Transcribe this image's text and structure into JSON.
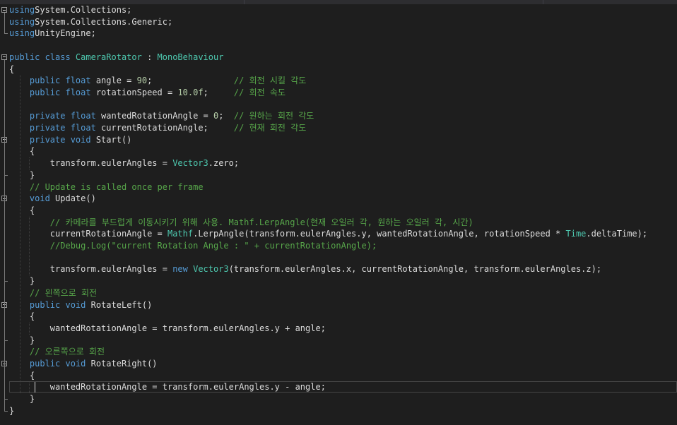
{
  "editor": {
    "language": "C#",
    "lines": [
      [
        [
          "kw",
          "using"
        ],
        [
          "",
          "System.Collections;"
        ]
      ],
      [
        [
          "kw",
          "using"
        ],
        [
          "",
          "System.Collections.Generic;"
        ]
      ],
      [
        [
          "kw",
          "using"
        ],
        [
          "",
          "UnityEngine;"
        ]
      ],
      [],
      [
        [
          "kw",
          "public class "
        ],
        [
          "ty",
          "CameraRotator"
        ],
        [
          "",
          " : "
        ],
        [
          "ty",
          "MonoBehaviour"
        ]
      ],
      [
        [
          "",
          "{"
        ]
      ],
      [
        [
          "",
          "    "
        ],
        [
          "kw",
          "public float"
        ],
        [
          "",
          " angle = "
        ],
        [
          "nm",
          "90"
        ],
        [
          "",
          ";                "
        ],
        [
          "cm",
          "// 회전 시킬 각도"
        ]
      ],
      [
        [
          "",
          "    "
        ],
        [
          "kw",
          "public float"
        ],
        [
          "",
          " rotationSpeed = "
        ],
        [
          "nm",
          "10.0f"
        ],
        [
          "",
          ";     "
        ],
        [
          "cm",
          "// 회전 속도"
        ]
      ],
      [],
      [
        [
          "",
          "    "
        ],
        [
          "kw",
          "private float"
        ],
        [
          "",
          " wantedRotationAngle = "
        ],
        [
          "nm",
          "0"
        ],
        [
          "",
          ";  "
        ],
        [
          "cm",
          "// 원하는 회전 각도"
        ]
      ],
      [
        [
          "",
          "    "
        ],
        [
          "kw",
          "private float"
        ],
        [
          "",
          " currentRotationAngle;     "
        ],
        [
          "cm",
          "// 현재 회전 각도"
        ]
      ],
      [
        [
          "",
          "    "
        ],
        [
          "kw",
          "private void"
        ],
        [
          "",
          " Start()"
        ]
      ],
      [
        [
          "",
          "    {"
        ]
      ],
      [
        [
          "",
          "        transform.eulerAngles = "
        ],
        [
          "ty",
          "Vector3"
        ],
        [
          "",
          ".zero;"
        ]
      ],
      [
        [
          "",
          "    }"
        ]
      ],
      [
        [
          "",
          "    "
        ],
        [
          "cm",
          "// Update is called once per frame"
        ]
      ],
      [
        [
          "",
          "    "
        ],
        [
          "kw",
          "void"
        ],
        [
          "",
          " Update()"
        ]
      ],
      [
        [
          "",
          "    {"
        ]
      ],
      [
        [
          "",
          "        "
        ],
        [
          "cm",
          "// 카메라를 부드럽게 이동시키기 위해 사용. Mathf.LerpAngle(현재 오일러 각, 원하는 오일러 각, 시간)"
        ]
      ],
      [
        [
          "",
          "        currentRotationAngle = "
        ],
        [
          "ty",
          "Mathf"
        ],
        [
          "",
          ".LerpAngle(transform.eulerAngles.y, wantedRotationAngle, rotationSpeed * "
        ],
        [
          "ty",
          "Time"
        ],
        [
          "",
          ".deltaTime);"
        ]
      ],
      [
        [
          "",
          "        "
        ],
        [
          "cm",
          "//Debug.Log(\"current Rotation Angle : \" + currentRotationAngle);"
        ]
      ],
      [],
      [
        [
          "",
          "        transform.eulerAngles = "
        ],
        [
          "kw",
          "new"
        ],
        [
          "",
          " "
        ],
        [
          "ty",
          "Vector3"
        ],
        [
          "",
          "(transform.eulerAngles.x, currentRotationAngle, transform.eulerAngles.z);"
        ]
      ],
      [
        [
          "",
          "    }"
        ]
      ],
      [
        [
          "",
          "    "
        ],
        [
          "cm",
          "// 왼쪽으로 회전"
        ]
      ],
      [
        [
          "",
          "    "
        ],
        [
          "kw",
          "public void"
        ],
        [
          "",
          " RotateLeft()"
        ]
      ],
      [
        [
          "",
          "    {"
        ]
      ],
      [
        [
          "",
          "        wantedRotationAngle = transform.eulerAngles.y + angle;"
        ]
      ],
      [
        [
          "",
          "    }"
        ]
      ],
      [
        [
          "",
          "    "
        ],
        [
          "cm",
          "// 오른쪽으로 회전"
        ]
      ],
      [
        [
          "",
          "    "
        ],
        [
          "kw",
          "public void"
        ],
        [
          "",
          " RotateRight()"
        ]
      ],
      [
        [
          "",
          "    {"
        ]
      ],
      [
        [
          "",
          "        wantedRotationAngle = transform.eulerAngles.y - angle;"
        ]
      ],
      [
        [
          "",
          "    }"
        ]
      ],
      [
        [
          "",
          "}"
        ]
      ]
    ],
    "fold_markers": [
      "line-1",
      "line-5",
      "line-12",
      "line-17",
      "line-26",
      "line-31"
    ],
    "current_line": 32,
    "colors": {
      "background": "#1e1e1e",
      "keyword": "#569cd6",
      "type": "#4ec9b0",
      "comment": "#57a64a",
      "number": "#b5cea8",
      "string": "#d69d85",
      "text": "#dcdcdc"
    }
  }
}
